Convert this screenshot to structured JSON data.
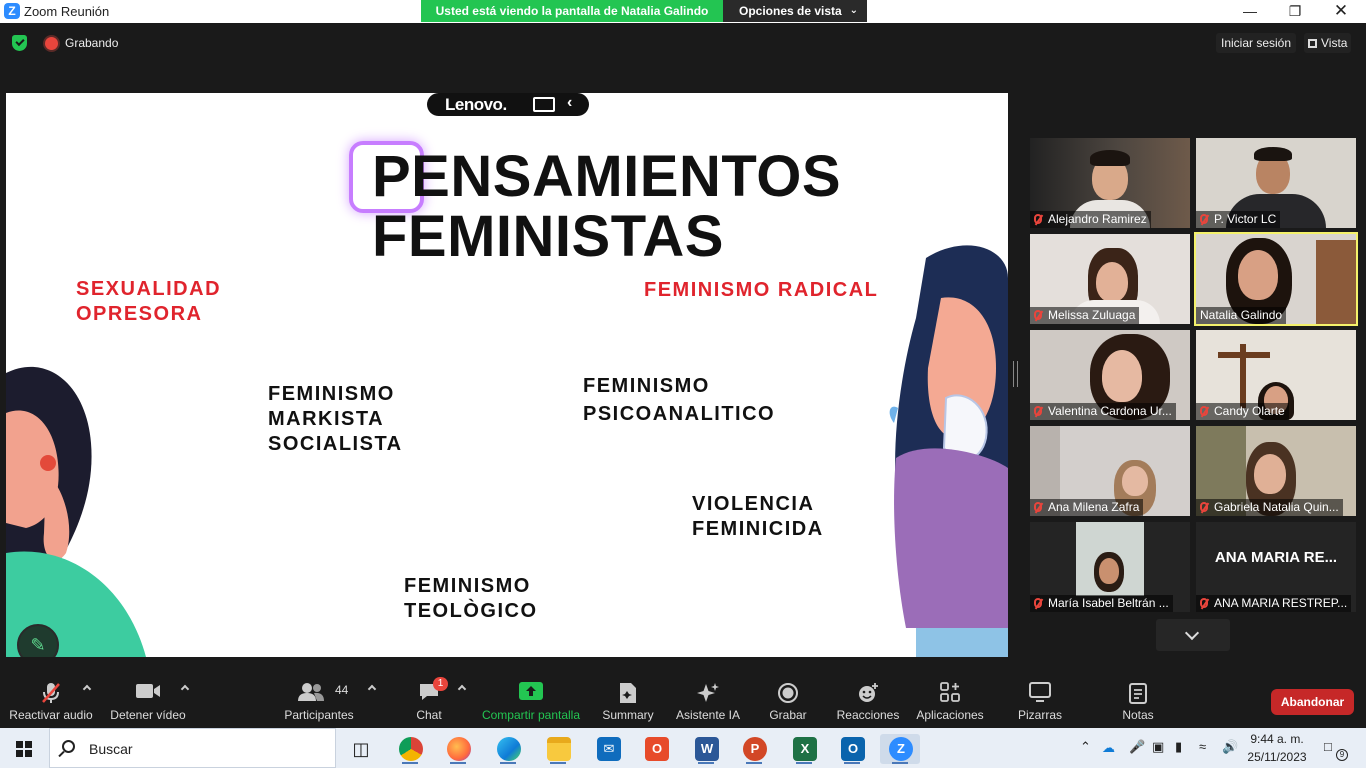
{
  "window": {
    "title": "Zoom Reunión",
    "share_banner": "Usted está viendo la pantalla de Natalia Galindo",
    "view_options": "Opciones de vista"
  },
  "topbar": {
    "recording": "Grabando",
    "signin": "Iniciar sesión",
    "view": "Vista"
  },
  "slide": {
    "brand": "Lenovo.",
    "title_line1": "PENSAMIENTOS",
    "title_line2": "FEMINISTAS",
    "labels": {
      "sexualidad": "SEXUALIDAD\nOPRESORA",
      "radical": "FEMINISMO RADICAL",
      "markista": "FEMINISMO\nMARKISTA\nSOCIALISTA",
      "psico": "FEMINISMO\nPSICOANALITICO",
      "violencia": "VIOLENCIA\nFEMINICIDA",
      "teologico": "FEMINISMO\nTEOLÒGICO"
    },
    "colors": {
      "accent_red": "#e0242d",
      "frame_purple": "#c77dff"
    }
  },
  "gallery": {
    "participants": [
      {
        "name": "Alejandro Ramirez"
      },
      {
        "name": "P. Victor LC"
      },
      {
        "name": "Melissa Zuluaga"
      },
      {
        "name": "Natalia Galindo",
        "active_speaker": true
      },
      {
        "name": "Valentina Cardona Ur..."
      },
      {
        "name": "Candy Olarte"
      },
      {
        "name": "Ana Milena Zafra"
      },
      {
        "name": "Gabriela Natalia Quin..."
      },
      {
        "name": "María Isabel Beltrán ..."
      },
      {
        "name": "ANA MARIA RESTREP...",
        "display": "ANA MARIA RE..."
      }
    ]
  },
  "toolbar": {
    "audio": "Reactivar audio",
    "video": "Detener vídeo",
    "participants": "Participantes",
    "participants_count": "44",
    "chat": "Chat",
    "chat_badge": "1",
    "share": "Compartir pantalla",
    "summary": "Summary",
    "ai": "Asistente IA",
    "record": "Grabar",
    "reactions": "Reacciones",
    "apps": "Aplicaciones",
    "whiteboards": "Pizarras",
    "notes": "Notas",
    "leave": "Abandonar"
  },
  "taskbar": {
    "search_placeholder": "Buscar",
    "time": "9:44 a. m.",
    "date": "25/11/2023",
    "notifications": "9",
    "apps": [
      "task-view",
      "chrome",
      "firefox",
      "edge",
      "file-explorer",
      "mail",
      "office",
      "word",
      "powerpoint",
      "excel",
      "outlook",
      "zoom"
    ]
  }
}
